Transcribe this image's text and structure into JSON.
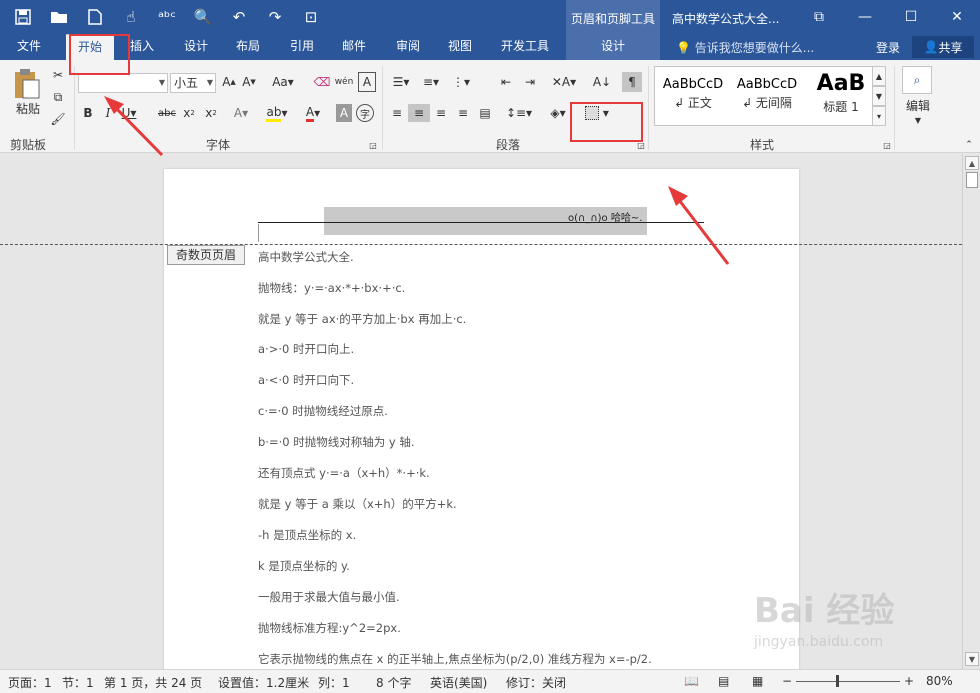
{
  "app": {
    "context_tab_group": "页眉和页脚工具",
    "doc_title": "高中数学公式大全...",
    "login": "登录",
    "share": "共享",
    "window_buttons": [
      "⧉",
      "—",
      "☐",
      "✕"
    ],
    "qat_icons": [
      "save-icon",
      "open-icon",
      "new-icon",
      "touch-mode-icon",
      "spelling-icon",
      "print-preview-icon",
      "undo-icon",
      "redo-icon",
      "customize-icon"
    ]
  },
  "tabs": [
    {
      "label": "文件"
    },
    {
      "label": "开始"
    },
    {
      "label": "插入"
    },
    {
      "label": "设计"
    },
    {
      "label": "布局"
    },
    {
      "label": "引用"
    },
    {
      "label": "邮件"
    },
    {
      "label": "审阅"
    },
    {
      "label": "视图"
    },
    {
      "label": "开发工具"
    },
    {
      "label": "设计"
    }
  ],
  "tellme": "告诉我您想要做什么...",
  "ribbon": {
    "clipboard": {
      "paste_label": "粘贴",
      "group_label": "剪贴板"
    },
    "font": {
      "font_name": "",
      "font_size": "小五",
      "group_label": "字体"
    },
    "paragraph": {
      "group_label": "段落"
    },
    "styles": {
      "group_label": "样式",
      "items": [
        {
          "sample": "AaBbCcD",
          "name": "↲ 正文"
        },
        {
          "sample": "AaBbCcD",
          "name": "↲ 无间隔"
        },
        {
          "sample": "AaB",
          "name": "标题 1"
        }
      ]
    },
    "editing": {
      "label": "编辑"
    }
  },
  "document": {
    "header_text": "o(∩_∩)o 哈哈~.",
    "header_tag": "奇数页页眉",
    "lines": [
      "高中数学公式大全.",
      "抛物线：y·=·ax·*+·bx·+·c.",
      "就是 y 等于 ax·的平方加上·bx 再加上·c.",
      "a·>·0 时开口向上.",
      "a·<·0 时开口向下.",
      "c·=·0 时抛物线经过原点.",
      "b·=·0 时抛物线对称轴为 y 轴.",
      "还有顶点式 y·=·a（x+h）*·+·k.",
      "就是 y 等于 a 乘以（x+h）的平方+k.",
      "-h 是顶点坐标的 x.",
      "k 是顶点坐标的 y.",
      "一般用于求最大值与最小值.",
      "抛物线标准方程:y^2=2px.",
      "它表示抛物线的焦点在 x 的正半轴上,焦点坐标为(p/2,0) 准线方程为 x=-p/2."
    ]
  },
  "status": {
    "page": "页面：1",
    "section": "节：1",
    "page_of": "第 1 页，共 24 页",
    "setting": "设置值：1.2厘米",
    "column": "列：1",
    "words": "8 个字",
    "language": "英语(美国)",
    "track": "修订：关闭",
    "zoom": "80%"
  },
  "watermark": {
    "brand": "Bai 经验",
    "url": "jingyan.baidu.com"
  },
  "colors": {
    "accent": "#2b579a",
    "annotation": "#e63a3a"
  }
}
